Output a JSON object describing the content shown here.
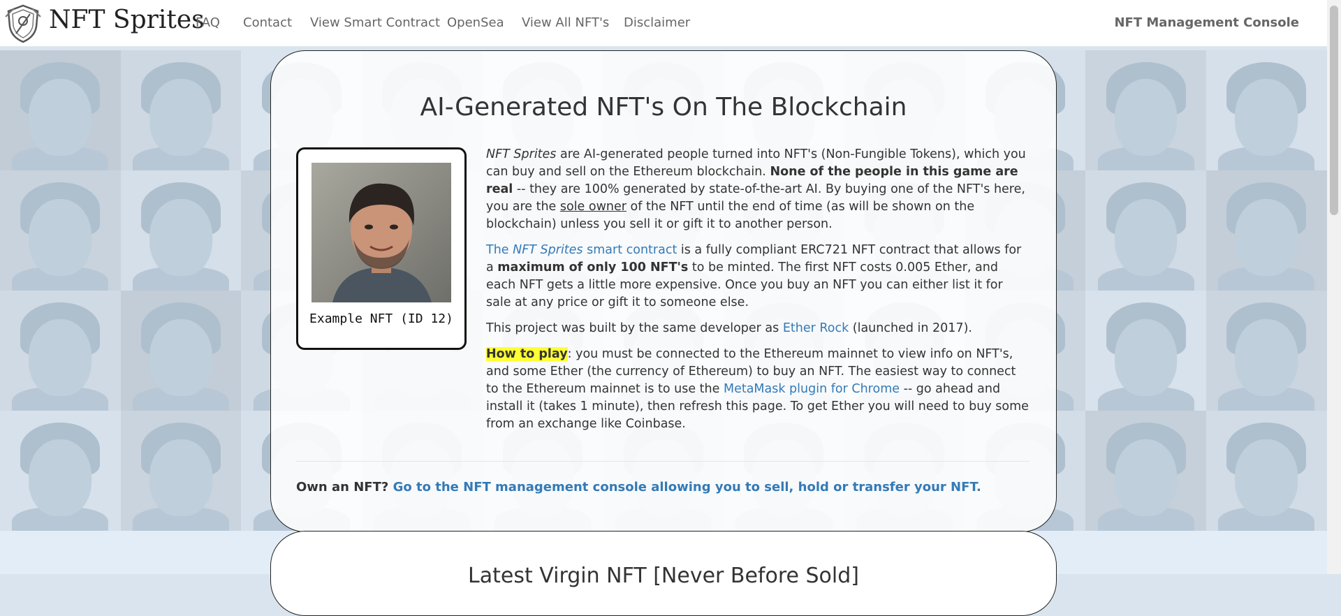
{
  "nav": {
    "brand": "NFT Sprites",
    "links": [
      "FAQ",
      "Contact",
      "View Smart Contract",
      "OpenSea",
      "View All NFT's",
      "Disclaimer"
    ],
    "console": "NFT Management Console"
  },
  "main": {
    "title": "AI-Generated NFT's On The Blockchain",
    "example_caption": "Example NFT (ID 12)",
    "p1": {
      "italic": "NFT Sprites",
      "t1": " are AI-generated people turned into NFT's (Non-Fungible Tokens), which you can buy and sell on the Ethereum blockchain. ",
      "bold": "None of the people in this game are real",
      "t2": " -- they are 100% generated by state-of-the-art AI. By buying one of the NFT's here, you are the ",
      "underline": "sole owner",
      "t3": " of the NFT until the end of time (as will be shown on the blockchain) unless you sell it or gift it to another person."
    },
    "p2": {
      "link_pre": "The ",
      "link_italic": "NFT Sprites",
      "link_post": " smart contract",
      "t1": " is a fully compliant ERC721 NFT contract that allows for a ",
      "bold": "maximum of only 100 NFT's",
      "t2": " to be minted. The first NFT costs 0.005 Ether, and each NFT gets a little more expensive. Once you buy an NFT you can either list it for sale at any price or gift it to someone else."
    },
    "p3": {
      "t1": "This project was built by the same developer as ",
      "link": "Ether Rock",
      "t2": " (launched in 2017)."
    },
    "p4": {
      "highlight": "How to play",
      "t1": ": you must be connected to the Ethereum mainnet to view info on NFT's, and some Ether (the currency of Ethereum) to buy an NFT. The easiest way to connect to the Ethereum mainnet is to use the ",
      "link": "MetaMask plugin for Chrome",
      "t2": " -- go ahead and install it (takes 1 minute), then refresh this page. To get Ether you will need to buy some from an exchange like Coinbase."
    },
    "own_label": "Own an NFT?",
    "own_link": "Go to the NFT management console allowing you to sell, hold or transfer your NFT."
  },
  "second": {
    "title": "Latest Virgin NFT [Never Before Sold]"
  },
  "icons": {
    "logo": "shield-logo-icon"
  },
  "colors": {
    "link": "#337ab7",
    "highlight": "#ffff33"
  }
}
